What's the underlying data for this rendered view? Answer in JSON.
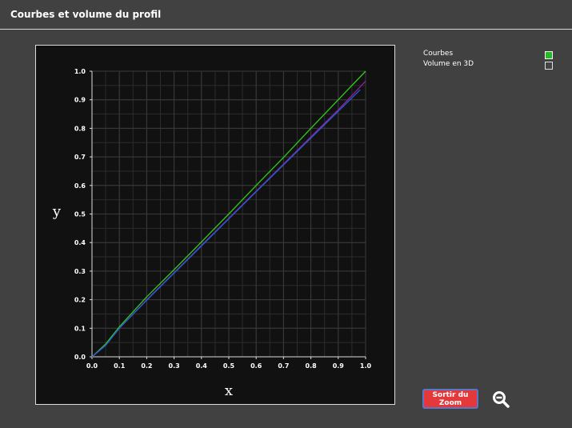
{
  "window": {
    "title": "Courbes et volume du profil"
  },
  "legend": {
    "items": [
      {
        "label": "Courbes",
        "checked": true
      },
      {
        "label": "Volume en 3D",
        "checked": false
      }
    ]
  },
  "controls": {
    "exit_zoom_label": "Sortir du Zoom",
    "zoom_out_icon": "zoom-out-icon"
  },
  "colors": {
    "background": "#414141",
    "plot_background": "#111111",
    "grid": "#3a3a3a",
    "series_green": "#2ecc1a",
    "series_purple": "#8a1fa0",
    "series_blue": "#2a5bd6",
    "button": "#e5383b"
  },
  "chart_data": {
    "type": "line",
    "xlabel": "x",
    "ylabel": "y",
    "xlim": [
      0,
      1
    ],
    "ylim": [
      0,
      1
    ],
    "xticks": [
      "0.0",
      "0.1",
      "0.2",
      "0.3",
      "0.4",
      "0.5",
      "0.6",
      "0.7",
      "0.8",
      "0.9",
      "1.0"
    ],
    "yticks": [
      "0.0",
      "0.1",
      "0.2",
      "0.3",
      "0.4",
      "0.5",
      "0.6",
      "0.7",
      "0.8",
      "0.9",
      "1.0"
    ],
    "grid": true,
    "series": [
      {
        "color": "#2ecc1a",
        "x": [
          0,
          0.05,
          0.1,
          0.2,
          0.3,
          0.4,
          0.5,
          0.6,
          0.7,
          0.8,
          0.9,
          1.0
        ],
        "y": [
          0,
          0.045,
          0.105,
          0.21,
          0.305,
          0.402,
          0.5,
          0.6,
          0.698,
          0.8,
          0.9,
          1.0
        ]
      },
      {
        "color": "#8a1fa0",
        "x": [
          0,
          0.05,
          0.1,
          0.2,
          0.3,
          0.4,
          0.5,
          0.6,
          0.7,
          0.8,
          0.9,
          1.0
        ],
        "y": [
          0,
          0.04,
          0.1,
          0.2,
          0.295,
          0.39,
          0.485,
          0.58,
          0.675,
          0.77,
          0.865,
          0.965
        ]
      },
      {
        "color": "#2a5bd6",
        "x": [
          0,
          0.05,
          0.1,
          0.2,
          0.3,
          0.4,
          0.5,
          0.6,
          0.7,
          0.8,
          0.9,
          0.98
        ],
        "y": [
          0,
          0.04,
          0.1,
          0.198,
          0.293,
          0.388,
          0.483,
          0.578,
          0.672,
          0.766,
          0.86,
          0.935
        ]
      }
    ]
  }
}
